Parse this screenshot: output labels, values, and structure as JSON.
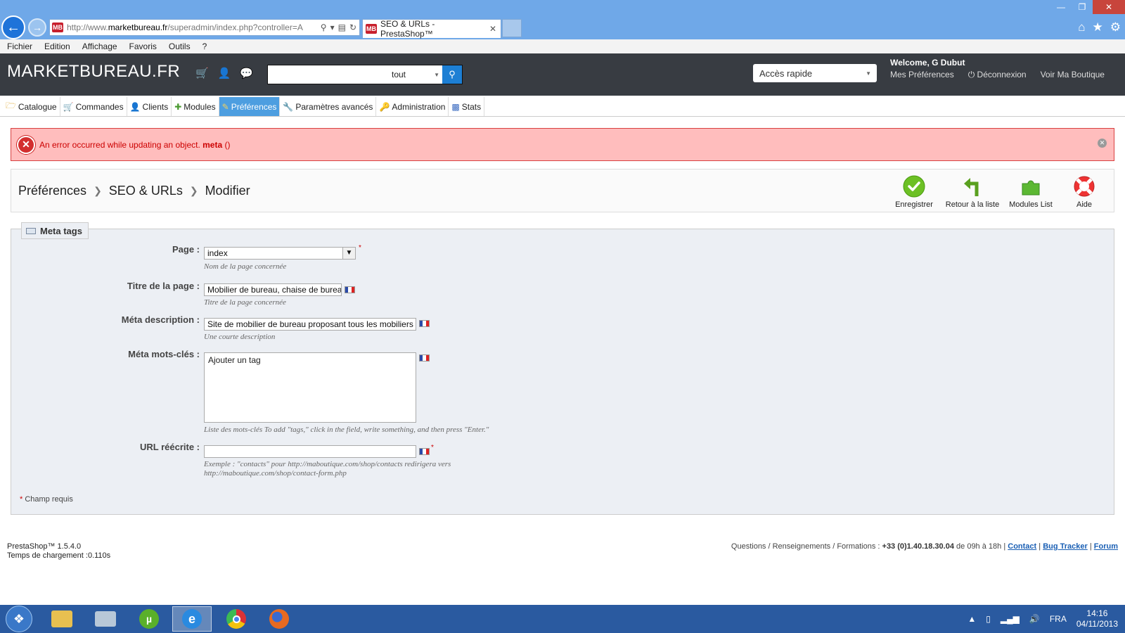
{
  "browser": {
    "url_prefix": "http://www.",
    "url_domain": "marketbureau.fr",
    "url_rest": "/superadmin/index.php?controller=A",
    "tab_title": "SEO & URLs - PrestaShop™",
    "favicon_text": "MB"
  },
  "menubar": [
    "Fichier",
    "Edition",
    "Affichage",
    "Favoris",
    "Outils",
    "?"
  ],
  "header": {
    "logo": "MARKETBUREAU.FR",
    "search_value": "",
    "search_scope": "tout",
    "quick_access": "Accès rapide",
    "welcome": "Welcome, G Dubut",
    "links": {
      "preferences": "Mes Préférences",
      "logout": "Déconnexion",
      "view_shop": "Voir Ma Boutique"
    }
  },
  "main_tabs": [
    {
      "label": "Catalogue",
      "icon": "folder-icon"
    },
    {
      "label": "Commandes",
      "icon": "cart-icon"
    },
    {
      "label": "Clients",
      "icon": "user-icon"
    },
    {
      "label": "Modules",
      "icon": "puzzle-icon"
    },
    {
      "label": "Préférences",
      "icon": "pencil-icon",
      "active": true
    },
    {
      "label": "Paramètres avancés",
      "icon": "wrench-icon"
    },
    {
      "label": "Administration",
      "icon": "key-icon"
    },
    {
      "label": "Stats",
      "icon": "bar-chart-icon"
    }
  ],
  "error": {
    "message": "An error occurred while updating an object.",
    "object": "meta",
    "suffix": "()"
  },
  "breadcrumb": [
    "Préférences",
    "SEO & URLs",
    "Modifier"
  ],
  "toolbar": {
    "save": "Enregistrer",
    "back": "Retour à la liste",
    "modules": "Modules List",
    "help": "Aide"
  },
  "form": {
    "legend": "Meta tags",
    "page": {
      "label": "Page :",
      "value": "index",
      "help": "Nom de la page concernée"
    },
    "title": {
      "label": "Titre de la page :",
      "value": "Mobilier de bureau, chaise de bureau",
      "help": "Titre de la page concernée"
    },
    "description": {
      "label": "Méta description :",
      "value": "Site de mobilier de bureau proposant tous les mobiliers",
      "help": "Une courte description"
    },
    "keywords": {
      "label": "Méta mots-clés :",
      "placeholder": "Ajouter un tag",
      "help": "Liste des mots-clés To add \"tags,\" click in the field, write something, and then press \"Enter.\""
    },
    "url": {
      "label": "URL réécrite :",
      "value": "",
      "help_line1": "Exemple : \"contacts\" pour http://maboutique.com/shop/contacts redirigera vers",
      "help_line2": "http://maboutique.com/shop/contact-form.php"
    },
    "required_note": "Champ requis"
  },
  "footer": {
    "version": "PrestaShop™ 1.5.4.0",
    "load_time": "Temps de chargement :0.110s",
    "contact_prefix": "Questions / Renseignements / Formations :",
    "phone": "+33 (0)1.40.18.30.04",
    "hours": "de 09h à 18h |",
    "link_contact": "Contact",
    "link_bug": "Bug Tracker",
    "link_forum": "Forum"
  },
  "taskbar": {
    "lang": "FRA",
    "time": "14:16",
    "date": "04/11/2013"
  },
  "colors": {
    "header_bg": "#383c42",
    "active_tab": "#4d9ee0",
    "error_bg": "#ffbdbd",
    "error_text": "#cc0000"
  }
}
